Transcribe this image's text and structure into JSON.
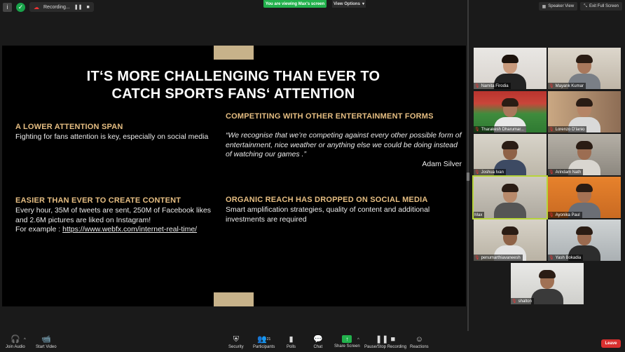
{
  "topbar": {
    "recording_label": "Recording...",
    "viewing_banner": "You are viewing Max's screen",
    "view_options": "View Options",
    "speaker_view": "Speaker View",
    "exit_full_screen": "Exit Full Screen"
  },
  "slide": {
    "title_line1": "IT‘S MORE CHALLENGING THAN EVER TO",
    "title_line2": "CATCH SPORTS FANS‘ ATTENTION",
    "block1_heading": "A LOWER ATTENTION SPAN",
    "block1_body": "Fighting for fans attention is key, especially on social media",
    "block2_heading": "COMPETITING WITH OTHER ENTERTAINMENT FORMS",
    "block2_quote": "“We recognise that we’re competing against every other possible form of entertainment, nice weather or anything else we could be doing instead of watching our games .”",
    "block2_author": "Adam Silver",
    "block3_heading": "EASIER THAN EVER TO CREATE CONTENT",
    "block3_body_line1": "Every hour, 35M of tweets are sent, 250M of Facebook likes",
    "block3_body_line2": "and 2.6M pictures are liked on Instagram!",
    "block3_example_prefix": "For example : ",
    "block3_link": "https://www.webfx.com/internet-real-time/",
    "block4_heading": "ORGANIC REACH HAS DROPPED ON SOCIAL MEDIA",
    "block4_body": "Smart amplification strategies, quality of content and additional investments are required",
    "accent_color": "#e6be82",
    "tab_color": "#c7b28a"
  },
  "participants": [
    {
      "name": "Namita Firodia"
    },
    {
      "name": "Mayank Kumar"
    },
    {
      "name": "Tharakesh Dharumar..."
    },
    {
      "name": "Lorenzo D'Ianio"
    },
    {
      "name": "Joshua Ivan"
    },
    {
      "name": "Arindam Nath"
    },
    {
      "name": "Max"
    },
    {
      "name": "Ayonika Paul"
    },
    {
      "name": "penumarthiavaneesh"
    },
    {
      "name": "Yash Bokadia"
    },
    {
      "name": "shalton"
    }
  ],
  "toolbar": {
    "join_audio": "Join Audio",
    "start_video": "Start Video",
    "security": "Security",
    "participants": "Participants",
    "participants_count": "21",
    "polls": "Polls",
    "chat": "Chat",
    "share_screen": "Share Screen",
    "pause_stop_recording": "Pause/Stop Recording",
    "reactions": "Reactions",
    "leave": "Leave"
  }
}
